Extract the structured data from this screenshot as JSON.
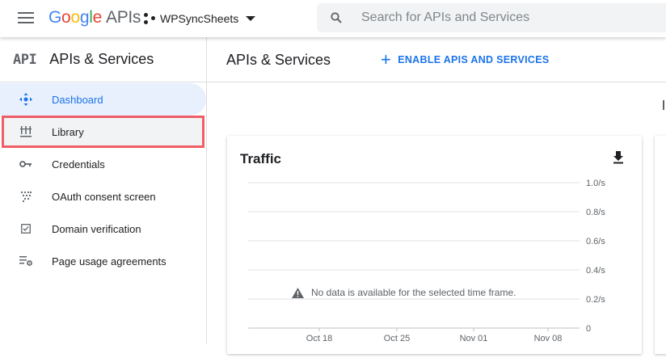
{
  "header": {
    "logo": {
      "g1": "G",
      "o1": "o",
      "o2": "o",
      "g2": "g",
      "l": "l",
      "e": "e",
      "apis": "APIs"
    },
    "project_name": "WPSyncSheets",
    "search_placeholder": "Search for APIs and Services"
  },
  "sidebar": {
    "badge": "API",
    "title": "APIs & Services",
    "items": [
      {
        "label": "Dashboard",
        "icon": "dashboard-icon",
        "active": true
      },
      {
        "label": "Library",
        "icon": "library-icon",
        "highlighted": true
      },
      {
        "label": "Credentials",
        "icon": "key-icon"
      },
      {
        "label": "OAuth consent screen",
        "icon": "oauth-dots-icon"
      },
      {
        "label": "Domain verification",
        "icon": "checkbox-icon"
      },
      {
        "label": "Page usage agreements",
        "icon": "settings-list-icon"
      }
    ]
  },
  "main": {
    "title": "APIs & Services",
    "enable_button": "ENABLE APIS AND SERVICES"
  },
  "traffic_card": {
    "title": "Traffic",
    "no_data_message": "No data is available for the selected time frame.",
    "y_ticks": [
      "1.0/s",
      "0.8/s",
      "0.6/s",
      "0.4/s",
      "0.2/s",
      "0"
    ],
    "x_ticks": [
      "Oct 18",
      "Oct 25",
      "Nov 01",
      "Nov 08"
    ]
  },
  "colors": {
    "accent": "#1a73e8",
    "active_bg": "#e8f0fe",
    "highlight_border": "#ef5d66",
    "google_blue": "#4285f4",
    "google_red": "#ea4335",
    "google_yellow": "#fbbc05",
    "google_green": "#34a853"
  }
}
